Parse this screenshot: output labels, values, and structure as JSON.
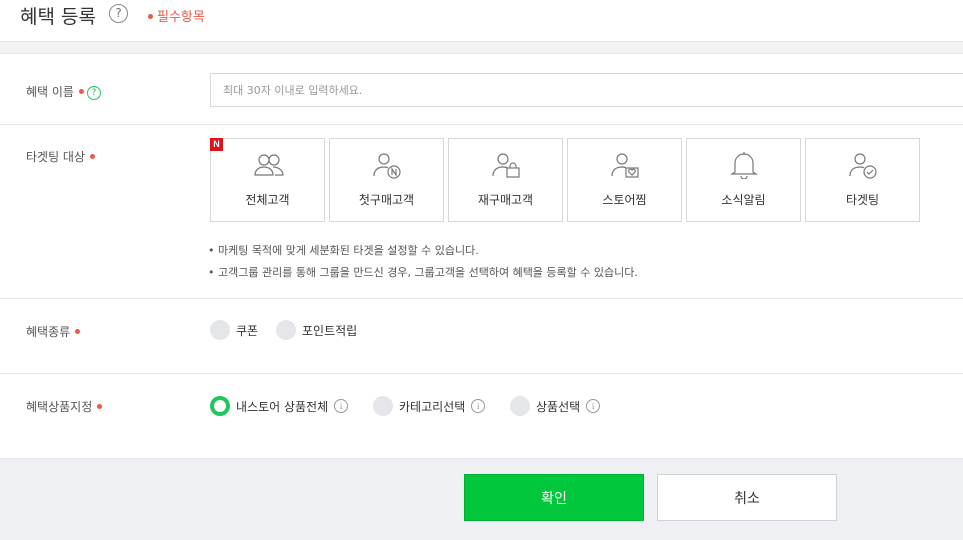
{
  "header": {
    "title": "혜택 등록",
    "help_icon": "question-circle-icon",
    "required_note": "필수항목"
  },
  "benefit_name": {
    "label": "혜택 이름",
    "placeholder": "최대 30자 이내로 입력하세요.",
    "value": ""
  },
  "targeting": {
    "label": "타겟팅 대상",
    "new_badge": "N",
    "cards": [
      {
        "label": "전체고객",
        "icon": "users-icon"
      },
      {
        "label": "첫구매고객",
        "icon": "user-new-icon"
      },
      {
        "label": "재구매고객",
        "icon": "user-bag-icon"
      },
      {
        "label": "스토어찜",
        "icon": "user-heart-icon"
      },
      {
        "label": "소식알림",
        "icon": "bell-icon"
      },
      {
        "label": "타겟팅",
        "icon": "user-check-icon"
      }
    ],
    "notes": [
      "• 마케팅 목적에 맞게 세분화된 타겟을 설정할 수 있습니다.",
      "• 고객그룹 관리를 통해 그룹을 만드신 경우, 그룹고객을 선택하여 혜택을 등록할 수 있습니다."
    ]
  },
  "benefit_type": {
    "label": "혜택종류",
    "options": [
      {
        "label": "쿠폰",
        "checked": false
      },
      {
        "label": "포인트적립",
        "checked": false
      }
    ]
  },
  "benefit_product": {
    "label": "혜택상품지정",
    "options": [
      {
        "label": "내스토어 상품전체",
        "checked": true
      },
      {
        "label": "카테고리선택",
        "checked": false
      },
      {
        "label": "상품선택",
        "checked": false
      }
    ]
  },
  "footer": {
    "confirm_label": "확인",
    "cancel_label": "취소"
  },
  "colors": {
    "accent_green": "#00c73c",
    "required_red": "#f15746"
  }
}
